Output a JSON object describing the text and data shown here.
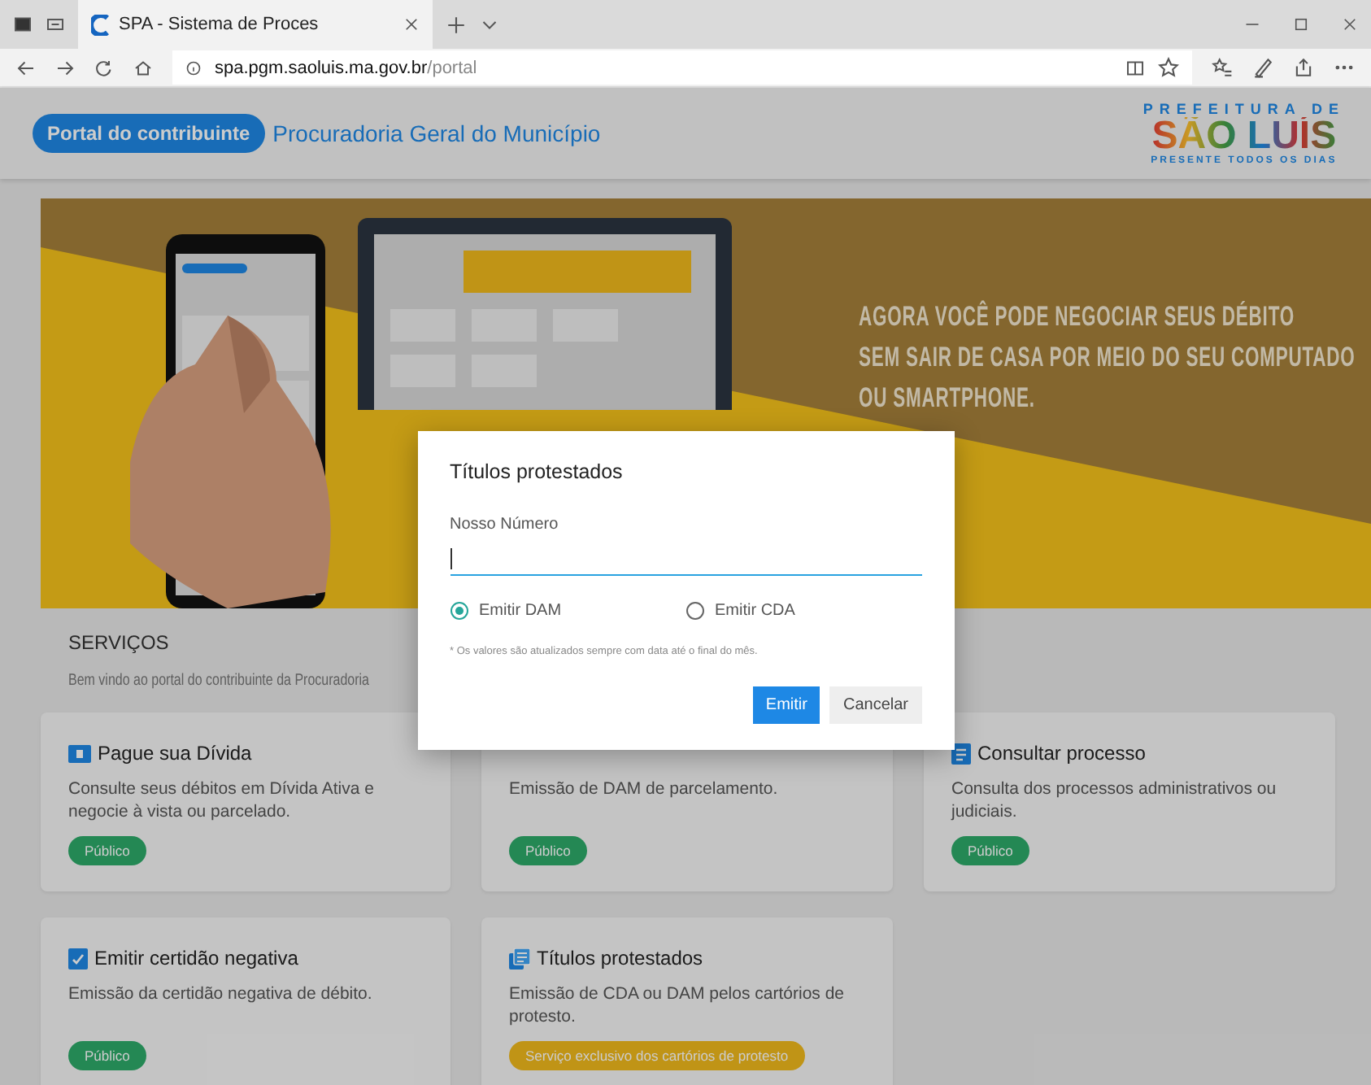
{
  "browser": {
    "tab_title": "SPA - Sistema de Proces",
    "address": {
      "host": "spa.pgm.saoluis.ma.gov.br",
      "path": "/portal"
    }
  },
  "header": {
    "badge": "Portal do contribuinte",
    "title": "Procuradoria Geral do Município",
    "logo": {
      "top": "PREFEITURA DE",
      "name": "SÃO LUÍS",
      "tagline": "PRESENTE TODOS OS DIAS"
    }
  },
  "banner": {
    "headline": [
      "AGORA VOCÊ PODE NEGOCIAR SEUS DÉBITO",
      "SEM SAIR DE CASA POR MEIO DO SEU COMPUTADO",
      "OU SMARTPHONE."
    ]
  },
  "services": {
    "title": "SERVIÇOS",
    "subtitle": "Bem vindo ao portal do contribuinte da Procuradoria",
    "cards": [
      {
        "kind": "payment",
        "title": "Pague sua Dívida",
        "description": "Consulte seus débitos em Dívida Ativa e negocie à vista ou parcelado.",
        "badge": {
          "kind": "public",
          "label": "Público"
        }
      },
      {
        "description": "Emissão de DAM de parcelamento.",
        "badge": {
          "kind": "public",
          "label": "Público"
        }
      },
      {
        "kind": "process",
        "title": "Consultar processo",
        "description": "Consulta dos processos administrativos ou judiciais.",
        "badge": {
          "kind": "public",
          "label": "Público"
        }
      },
      {
        "kind": "certificate",
        "title": "Emitir certidão negativa",
        "description": "Emissão da certidão negativa de débito.",
        "badge": {
          "kind": "public",
          "label": "Público"
        }
      },
      {
        "kind": "protest",
        "title": "Títulos protestados",
        "description": "Emissão de CDA ou DAM pelos cartórios de protesto.",
        "badge": {
          "kind": "exclusive",
          "label": "Serviço exclusivo dos cartórios de protesto"
        }
      }
    ]
  },
  "dialog": {
    "title": "Títulos protestados",
    "field": {
      "label": "Nosso Número"
    },
    "options": [
      {
        "label": "Emitir DAM",
        "selected": true
      },
      {
        "label": "Emitir CDA",
        "selected": false
      }
    ],
    "note": "* Os valores são atualizados sempre com data até o final do mês.",
    "buttons": [
      {
        "kind": "primary",
        "label": "Emitir"
      },
      {
        "kind": "secondary",
        "label": "Cancelar"
      }
    ]
  }
}
